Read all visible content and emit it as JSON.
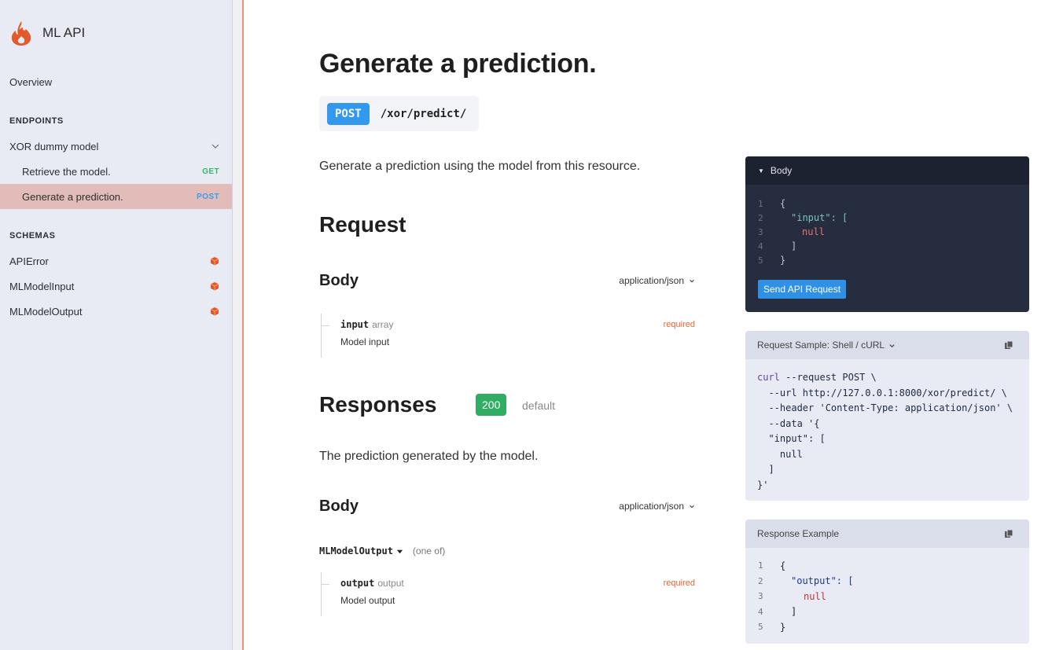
{
  "sidebar": {
    "app_title": "ML API",
    "overview": "Overview",
    "endpoints_header": "ENDPOINTS",
    "group": "XOR dummy model",
    "endpoints": [
      {
        "label": "Retrieve the model.",
        "method": "GET",
        "method_color": "#3ab36b"
      },
      {
        "label": "Generate a prediction.",
        "method": "POST",
        "method_color": "#3b9ced",
        "active": true
      }
    ],
    "schemas_header": "SCHEMAS",
    "schemas": [
      "APIError",
      "MLModelInput",
      "MLModelOutput"
    ]
  },
  "main": {
    "title": "Generate a prediction.",
    "method": "POST",
    "path": "/xor/predict/",
    "description": "Generate a prediction using the model from this resource.",
    "request": {
      "heading": "Request",
      "body_heading": "Body",
      "content_type": "application/json",
      "properties": [
        {
          "name": "input",
          "type": "array",
          "description": "Model input",
          "required": "required"
        }
      ]
    },
    "responses": {
      "heading": "Responses",
      "status": "200",
      "status_label": "default",
      "description": "The prediction generated by the model.",
      "body_heading": "Body",
      "content_type": "application/json",
      "schema": "MLModelOutput",
      "schema_note": "(one of)",
      "properties": [
        {
          "name": "output",
          "type": "output",
          "description": "Model output",
          "required": "required"
        }
      ]
    }
  },
  "try_it": {
    "header": "Body",
    "lines": [
      "{",
      "\"input\": [",
      "null",
      "]",
      "}"
    ],
    "send_label": "Send API Request"
  },
  "request_sample": {
    "header": "Request Sample: Shell / cURL",
    "lines": [
      "curl --request POST \\",
      "  --url http://127.0.0.1:8000/xor/predict/ \\",
      "  --header 'Content-Type: application/json' \\",
      "  --data '{",
      "  \"input\": [",
      "    null",
      "  ]",
      "}'"
    ]
  },
  "response_example": {
    "header": "Response Example",
    "lines": [
      "{",
      "\"output\": [",
      "null",
      "]",
      "}"
    ]
  }
}
